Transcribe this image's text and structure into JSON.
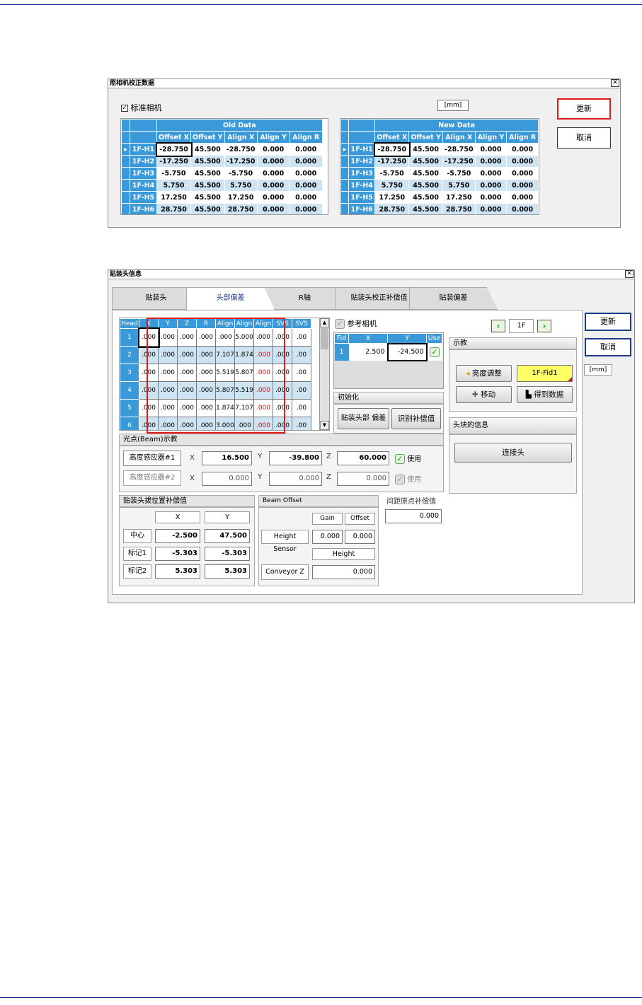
{
  "dialog1": {
    "title": "照相机校正数据",
    "checkbox_label": "标准相机",
    "unit": "[mm]",
    "update_button": "更新",
    "cancel_button": "取消",
    "old_table": {
      "group_header": "Old Data",
      "columns": [
        "Offset X",
        "Offset Y",
        "Align X",
        "Align Y",
        "Align R"
      ],
      "rows": [
        {
          "head": "1F-H1",
          "values": [
            "-28.750",
            "45.500",
            "-28.750",
            "0.000",
            "0.000"
          ]
        },
        {
          "head": "1F-H2",
          "values": [
            "-17.250",
            "45.500",
            "-17.250",
            "0.000",
            "0.000"
          ]
        },
        {
          "head": "1F-H3",
          "values": [
            "-5.750",
            "45.500",
            "-5.750",
            "0.000",
            "0.000"
          ]
        },
        {
          "head": "1F-H4",
          "values": [
            "5.750",
            "45.500",
            "5.750",
            "0.000",
            "0.000"
          ]
        },
        {
          "head": "1F-H5",
          "values": [
            "17.250",
            "45.500",
            "17.250",
            "0.000",
            "0.000"
          ]
        },
        {
          "head": "1F-H6",
          "values": [
            "28.750",
            "45.500",
            "28.750",
            "0.000",
            "0.000"
          ]
        }
      ]
    },
    "new_table": {
      "group_header": "New Data",
      "columns": [
        "Offset X",
        "Offset Y",
        "Align X",
        "Align Y",
        "Align R"
      ],
      "rows": [
        {
          "head": "1F-H1",
          "values": [
            "-28.750",
            "45.500",
            "-28.750",
            "0.000",
            "0.000"
          ]
        },
        {
          "head": "1F-H2",
          "values": [
            "-17.250",
            "45.500",
            "-17.250",
            "0.000",
            "0.000"
          ]
        },
        {
          "head": "1F-H3",
          "values": [
            "-5.750",
            "45.500",
            "-5.750",
            "0.000",
            "0.000"
          ]
        },
        {
          "head": "1F-H4",
          "values": [
            "5.750",
            "45.500",
            "5.750",
            "0.000",
            "0.000"
          ]
        },
        {
          "head": "1F-H5",
          "values": [
            "17.250",
            "45.500",
            "17.250",
            "0.000",
            "0.000"
          ]
        },
        {
          "head": "1F-H6",
          "values": [
            "28.750",
            "45.500",
            "28.750",
            "0.000",
            "0.000"
          ]
        }
      ]
    }
  },
  "dialog2": {
    "title": "贴装头信息",
    "tabs": [
      "贴装头",
      "头部偏差",
      "R轴",
      "贴装头校正补偿值",
      "贴装偏差"
    ],
    "head_table": {
      "columns": [
        "Head",
        "X",
        "Y",
        "Z",
        "R",
        "Align",
        "Align",
        "Align",
        "SVS",
        "SVS"
      ],
      "rows": [
        [
          "1",
          ".000",
          ".000",
          ".000",
          ".000",
          ".000",
          "5.000",
          ".000",
          ".000",
          ".00"
        ],
        [
          "2",
          ".000",
          ".000",
          ".000",
          ".000",
          "7.107",
          "1.874",
          ".000",
          ".000",
          ".00"
        ],
        [
          "3",
          ".000",
          ".000",
          ".000",
          ".000",
          "5.519",
          "5.807",
          ".000",
          ".000",
          ".00"
        ],
        [
          "4",
          ".000",
          ".000",
          ".000",
          ".000",
          "5.807",
          "5.519",
          ".000",
          ".000",
          ".00"
        ],
        [
          "5",
          ".000",
          ".000",
          ".000",
          ".000",
          "1.874",
          "7.107",
          ".000",
          ".000",
          ".00"
        ],
        [
          "6",
          ".000",
          ".000",
          ".000",
          ".000",
          "3.000",
          ".000",
          ".000",
          ".000",
          ".00"
        ]
      ]
    },
    "ref_camera_label": "参考相机",
    "fid_table": {
      "columns": [
        "Fid",
        "X",
        "Y",
        "Use"
      ],
      "row": [
        "1",
        "2.500",
        "-24.500"
      ]
    },
    "init_label": "初始化",
    "init_btn1": "贴装头部 偏差",
    "init_btn2": "识别补偿值",
    "nav_value": "1F",
    "teach_label": "示教",
    "brightness_btn": "亮度调整",
    "fid_btn": "1F-Fid1",
    "move_btn": "移动",
    "getdata_btn": "得到数据",
    "headblock_label": "头块的信息",
    "connect_btn": "连接头",
    "update_button": "更新",
    "cancel_button": "取消",
    "unit": "[mm]",
    "beam_label": "光点(Beam)示教",
    "sensor1": {
      "label": "高度感应器#1",
      "x": "16.500",
      "y": "-39.800",
      "z": "60.000",
      "use": "使用"
    },
    "sensor2": {
      "label": "高度感应器#2",
      "x": "0.000",
      "y": "0.000",
      "z": "0.000",
      "use": "使用"
    },
    "axis_x": "X",
    "axis_y": "Y",
    "axis_z": "Z",
    "comp_label": "贴装头拔位置补偿值",
    "comp_col_x": "X",
    "comp_col_y": "Y",
    "comp_rows": [
      {
        "label": "中心",
        "x": "-2.500",
        "y": "47.500"
      },
      {
        "label": "标记1",
        "x": "-5.303",
        "y": "-5.303"
      },
      {
        "label": "标记2",
        "x": "5.303",
        "y": "5.303"
      }
    ],
    "beam_offset_label": "Beam Offset",
    "gain_label": "Gain",
    "offset_label": "Offset",
    "height_sensor_label": "Height Sensor",
    "gain_value": "0.000",
    "offset_value": "0.000",
    "height_label": "Height",
    "conveyor_label": "Conveyor Z",
    "conveyor_value": "0.000",
    "origin_label": "间距原点补偿值",
    "origin_value": "0.000"
  }
}
